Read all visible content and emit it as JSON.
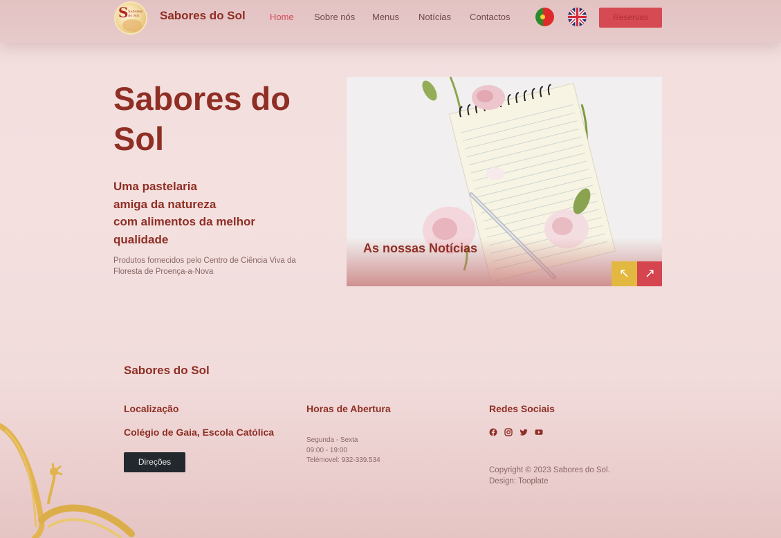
{
  "header": {
    "brand": "Sabores do Sol",
    "logo_text": "S",
    "logo_small_text": "Sabores do Sol",
    "nav": [
      "Home",
      "Sobre nós",
      "Menus",
      "Notícias",
      "Contactos"
    ],
    "active_nav": "Home",
    "reservas_label": "Reservas",
    "languages": [
      "pt",
      "en"
    ]
  },
  "hero": {
    "title": "Sabores do Sol",
    "tagline_lines": [
      "Uma pastelaria",
      "amiga da natureza",
      "com alimentos da melhor",
      "qualidade"
    ],
    "subtitle": "Produtos fornecidos pelo Centro de Ciência Viva da Floresta de Proença-a-Nova"
  },
  "news": {
    "title": "As nossas Notícias",
    "prev_icon": "arrow-up-left-icon",
    "next_icon": "arrow-up-right-icon"
  },
  "footer": {
    "brand": "Sabores do Sol",
    "location_heading": "Localização",
    "location": "Colégio de Gaia, Escola Católica",
    "directions_label": "Direções",
    "hours_heading": "Horas de Abertura",
    "hours_days": "Segunda - Sexta",
    "hours_time": "09:00 - 19:00",
    "phone": "Telémovel: 932-339.534",
    "social_heading": "Redes Sociais",
    "social_icons": [
      "facebook-icon",
      "instagram-icon",
      "twitter-icon",
      "youtube-icon"
    ],
    "copyright": "Copyright © 2023 Sabores do Sol.",
    "design": "Design: Tooplate"
  },
  "colors": {
    "brand_red": "#8f2e24",
    "accent_red": "#d5454f",
    "accent_yellow": "#e2b840",
    "dark_button": "#23282e"
  }
}
